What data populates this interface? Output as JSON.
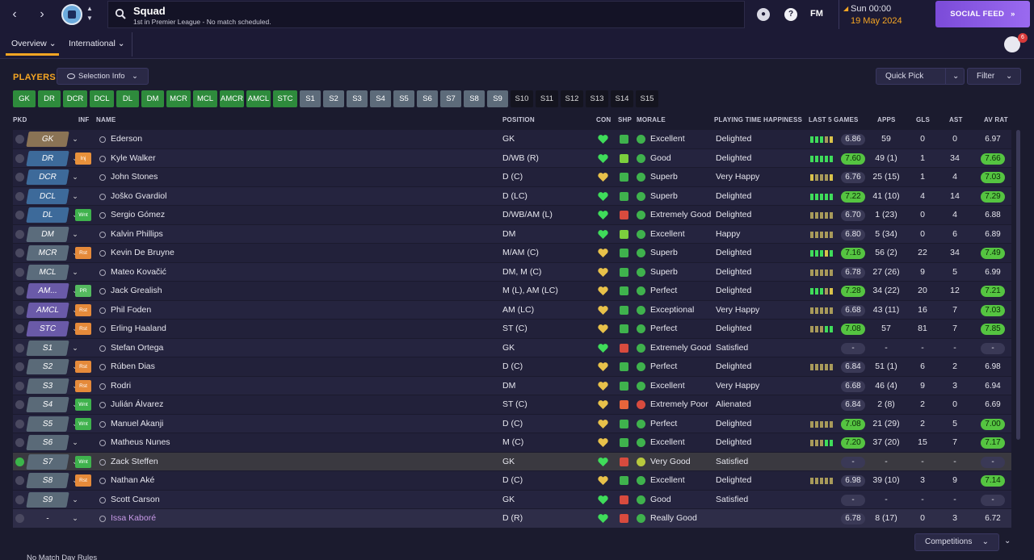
{
  "header": {
    "title": "Squad",
    "subtitle": "1st in Premier League - No match scheduled.",
    "fm_logo": "FM",
    "date_time": "Sun 00:00",
    "date_day": "19 May 2024",
    "social_feed": "SOCIAL FEED",
    "notification_count": "6"
  },
  "subnav": {
    "overview": "Overview",
    "international": "International"
  },
  "players": {
    "title": "PLAYERS",
    "selection_info": "Selection Info",
    "quick_pick": "Quick Pick",
    "filter": "Filter"
  },
  "chips": [
    {
      "label": "GK",
      "type": "filled"
    },
    {
      "label": "DR",
      "type": "filled"
    },
    {
      "label": "DCR",
      "type": "filled"
    },
    {
      "label": "DCL",
      "type": "filled"
    },
    {
      "label": "DL",
      "type": "filled"
    },
    {
      "label": "DM",
      "type": "filled"
    },
    {
      "label": "MCR",
      "type": "filled"
    },
    {
      "label": "MCL",
      "type": "filled"
    },
    {
      "label": "AMCR",
      "type": "filled"
    },
    {
      "label": "AMCL",
      "type": "filled"
    },
    {
      "label": "STC",
      "type": "filled"
    },
    {
      "label": "S1",
      "type": "sub"
    },
    {
      "label": "S2",
      "type": "sub"
    },
    {
      "label": "S3",
      "type": "sub"
    },
    {
      "label": "S4",
      "type": "sub"
    },
    {
      "label": "S5",
      "type": "sub"
    },
    {
      "label": "S6",
      "type": "sub"
    },
    {
      "label": "S7",
      "type": "sub"
    },
    {
      "label": "S8",
      "type": "sub"
    },
    {
      "label": "S9",
      "type": "sub"
    },
    {
      "label": "S10",
      "type": "res"
    },
    {
      "label": "S11",
      "type": "res"
    },
    {
      "label": "S12",
      "type": "res"
    },
    {
      "label": "S13",
      "type": "res"
    },
    {
      "label": "S14",
      "type": "res"
    },
    {
      "label": "S15",
      "type": "res"
    }
  ],
  "columns": {
    "pkd": "PKD",
    "inf": "INF",
    "name": "NAME",
    "position": "POSITION",
    "con": "CON",
    "shp": "SHP",
    "morale": "MORALE",
    "pth": "PLAYING TIME HAPPINESS",
    "last5": "LAST 5 GAMES",
    "apps": "APPS",
    "gls": "GLS",
    "ast": "AST",
    "avrat": "AV RAT"
  },
  "colors": {
    "accent": "#f6a623",
    "gk": "#8a7355",
    "defence": "#3d6a9a",
    "midfield": "#5b6c7c",
    "attack": "#6a5aa8",
    "sub": "#5a6a78",
    "good": "#55c441"
  },
  "rows": [
    {
      "pkd": "GK",
      "pos_color": "gk",
      "inf": "",
      "name": "Ederson",
      "position": "GK",
      "con": "green",
      "shp": "up",
      "morale": "Excellent",
      "mor": "green",
      "pth": "Delighted",
      "form": "gggmy",
      "last5": "6.86",
      "last5_good": false,
      "apps": "59",
      "gls": "0",
      "ast": "0",
      "avrat": "6.97",
      "avrat_style": "plain"
    },
    {
      "pkd": "DR",
      "pos_color": "defence",
      "inf": "Inj",
      "name": "Kyle Walker",
      "position": "D/WB (R)",
      "con": "green",
      "shp": "flat",
      "morale": "Good",
      "mor": "green",
      "pth": "Delighted",
      "form": "ggggg",
      "last5": "7.60",
      "last5_good": true,
      "apps": "49 (1)",
      "gls": "1",
      "ast": "34",
      "avrat": "7.66",
      "avrat_style": "good"
    },
    {
      "pkd": "DCR",
      "pos_color": "defence",
      "inf": "",
      "name": "John Stones",
      "position": "D (C)",
      "con": "yellow",
      "shp": "up",
      "morale": "Superb",
      "mor": "green",
      "pth": "Very Happy",
      "form": "ymmmy",
      "last5": "6.76",
      "last5_good": false,
      "apps": "25 (15)",
      "gls": "1",
      "ast": "4",
      "avrat": "7.03",
      "avrat_style": "good"
    },
    {
      "pkd": "DCL",
      "pos_color": "defence",
      "inf": "",
      "name": "Joško Gvardiol",
      "position": "D (LC)",
      "con": "green",
      "shp": "up",
      "morale": "Superb",
      "mor": "green",
      "pth": "Delighted",
      "form": "ggggg",
      "last5": "7.22",
      "last5_good": true,
      "apps": "41 (10)",
      "gls": "4",
      "ast": "14",
      "avrat": "7.29",
      "avrat_style": "good"
    },
    {
      "pkd": "DL",
      "pos_color": "defence",
      "inf": "Wnt",
      "name": "Sergio Gómez",
      "position": "D/WB/AM (L)",
      "con": "green",
      "shp": "down",
      "morale": "Extremely Good",
      "mor": "green",
      "pth": "Delighted",
      "form": "mmmmm",
      "last5": "6.70",
      "last5_good": false,
      "apps": "1 (23)",
      "gls": "0",
      "ast": "4",
      "avrat": "6.88",
      "avrat_style": "plain"
    },
    {
      "pkd": "DM",
      "pos_color": "midfield",
      "inf": "",
      "name": "Kalvin Phillips",
      "position": "DM",
      "con": "green",
      "shp": "flat",
      "morale": "Excellent",
      "mor": "green",
      "pth": "Happy",
      "form": "mmmmm",
      "last5": "6.80",
      "last5_good": false,
      "apps": "5 (34)",
      "gls": "0",
      "ast": "6",
      "avrat": "6.89",
      "avrat_style": "plain"
    },
    {
      "pkd": "MCR",
      "pos_color": "midfield",
      "inf": "Rst",
      "name": "Kevin De Bruyne",
      "position": "M/AM (C)",
      "con": "yellow",
      "shp": "up",
      "morale": "Superb",
      "mor": "green",
      "pth": "Delighted",
      "form": "gggyg",
      "last5": "7.16",
      "last5_good": true,
      "apps": "56 (2)",
      "gls": "22",
      "ast": "34",
      "avrat": "7.49",
      "avrat_style": "good"
    },
    {
      "pkd": "MCL",
      "pos_color": "midfield",
      "inf": "",
      "name": "Mateo Kovačić",
      "position": "DM, M (C)",
      "con": "yellow",
      "shp": "up",
      "morale": "Superb",
      "mor": "green",
      "pth": "Delighted",
      "form": "mmmmm",
      "last5": "6.78",
      "last5_good": false,
      "apps": "27 (26)",
      "gls": "9",
      "ast": "5",
      "avrat": "6.99",
      "avrat_style": "plain"
    },
    {
      "pkd": "AM...",
      "pos_color": "attack",
      "inf": "PR",
      "name": "Jack Grealish",
      "position": "M (L), AM (LC)",
      "con": "yellow",
      "shp": "up",
      "morale": "Perfect",
      "mor": "green",
      "pth": "Delighted",
      "form": "gggmy",
      "last5": "7.28",
      "last5_good": true,
      "apps": "34 (22)",
      "gls": "20",
      "ast": "12",
      "avrat": "7.21",
      "avrat_style": "good"
    },
    {
      "pkd": "AMCL",
      "pos_color": "attack",
      "inf": "Rst",
      "name": "Phil Foden",
      "position": "AM (LC)",
      "con": "yellow",
      "shp": "up",
      "morale": "Exceptional",
      "mor": "green",
      "pth": "Very Happy",
      "form": "mmmmm",
      "last5": "6.68",
      "last5_good": false,
      "apps": "43 (11)",
      "gls": "16",
      "ast": "7",
      "avrat": "7.03",
      "avrat_style": "good"
    },
    {
      "pkd": "STC",
      "pos_color": "attack",
      "inf": "Rst",
      "name": "Erling Haaland",
      "position": "ST (C)",
      "con": "yellow",
      "shp": "up",
      "morale": "Perfect",
      "mor": "green",
      "pth": "Delighted",
      "form": "mmmgg",
      "last5": "7.08",
      "last5_good": true,
      "apps": "57",
      "gls": "81",
      "ast": "7",
      "avrat": "7.85",
      "avrat_style": "good"
    },
    {
      "pkd": "S1",
      "pos_color": "sub",
      "inf": "",
      "name": "Stefan Ortega",
      "position": "GK",
      "con": "green",
      "shp": "down",
      "morale": "Extremely Good",
      "mor": "green",
      "pth": "Satisfied",
      "form": "",
      "last5": "-",
      "last5_good": false,
      "apps": "-",
      "gls": "-",
      "ast": "-",
      "avrat": "-",
      "avrat_style": "dash"
    },
    {
      "pkd": "S2",
      "pos_color": "sub",
      "inf": "Rst",
      "name": "Rúben Dias",
      "position": "D (C)",
      "con": "yellow",
      "shp": "up",
      "morale": "Perfect",
      "mor": "green",
      "pth": "Delighted",
      "form": "mmmmm",
      "last5": "6.84",
      "last5_good": false,
      "apps": "51 (1)",
      "gls": "6",
      "ast": "2",
      "avrat": "6.98",
      "avrat_style": "plain"
    },
    {
      "pkd": "S3",
      "pos_color": "sub",
      "inf": "Rst",
      "name": "Rodri",
      "position": "DM",
      "con": "yellow",
      "shp": "up",
      "morale": "Excellent",
      "mor": "green",
      "pth": "Very Happy",
      "form": "",
      "last5": "6.68",
      "last5_good": false,
      "apps": "46 (4)",
      "gls": "9",
      "ast": "3",
      "avrat": "6.94",
      "avrat_style": "plain"
    },
    {
      "pkd": "S4",
      "pos_color": "sub",
      "inf": "Wnt",
      "name": "Julián Álvarez",
      "position": "ST (C)",
      "con": "yellow",
      "shp": "warn",
      "morale": "Extremely Poor",
      "mor": "red",
      "pth": "Alienated",
      "form": "",
      "last5": "6.84",
      "last5_good": false,
      "apps": "2 (8)",
      "gls": "2",
      "ast": "0",
      "avrat": "6.69",
      "avrat_style": "plain"
    },
    {
      "pkd": "S5",
      "pos_color": "sub",
      "inf": "Wnt",
      "name": "Manuel Akanji",
      "position": "D (C)",
      "con": "yellow",
      "shp": "up",
      "morale": "Perfect",
      "mor": "green",
      "pth": "Delighted",
      "form": "mmmmm",
      "last5": "7.08",
      "last5_good": true,
      "apps": "21 (29)",
      "gls": "2",
      "ast": "5",
      "avrat": "7.00",
      "avrat_style": "good"
    },
    {
      "pkd": "S6",
      "pos_color": "sub",
      "inf": "",
      "name": "Matheus Nunes",
      "position": "M (C)",
      "con": "yellow",
      "shp": "up",
      "morale": "Excellent",
      "mor": "green",
      "pth": "Delighted",
      "form": "mmmgg",
      "last5": "7.20",
      "last5_good": true,
      "apps": "37 (20)",
      "gls": "15",
      "ast": "7",
      "avrat": "7.17",
      "avrat_style": "good"
    },
    {
      "pkd": "S7",
      "pos_color": "sub",
      "inf": "Wnt",
      "name": "Zack Steffen",
      "position": "GK",
      "con": "green",
      "shp": "down",
      "morale": "Very Good",
      "mor": "yellow",
      "pth": "Satisfied",
      "form": "",
      "last5": "-",
      "last5_good": false,
      "apps": "-",
      "gls": "-",
      "ast": "-",
      "avrat": "-",
      "avrat_style": "dash",
      "picked": true
    },
    {
      "pkd": "S8",
      "pos_color": "sub",
      "inf": "Rst",
      "name": "Nathan Aké",
      "position": "D (C)",
      "con": "yellow",
      "shp": "up",
      "morale": "Excellent",
      "mor": "green",
      "pth": "Delighted",
      "form": "mmmmm",
      "last5": "6.98",
      "last5_good": false,
      "apps": "39 (10)",
      "gls": "3",
      "ast": "9",
      "avrat": "7.14",
      "avrat_style": "good"
    },
    {
      "pkd": "S9",
      "pos_color": "sub",
      "inf": "",
      "name": "Scott Carson",
      "position": "GK",
      "con": "green",
      "shp": "down",
      "morale": "Good",
      "mor": "green",
      "pth": "Satisfied",
      "form": "",
      "last5": "-",
      "last5_good": false,
      "apps": "-",
      "gls": "-",
      "ast": "-",
      "avrat": "-",
      "avrat_style": "dash"
    },
    {
      "pkd": "-",
      "pos_color": "none",
      "inf": "",
      "name": "Issa Kaboré",
      "position": "D (R)",
      "con": "green",
      "shp": "down",
      "morale": "Really Good",
      "mor": "green",
      "pth": "",
      "form": "",
      "last5": "6.78",
      "last5_good": false,
      "apps": "8 (17)",
      "gls": "0",
      "ast": "3",
      "avrat": "6.72",
      "avrat_style": "plain",
      "loan": true
    }
  ],
  "footer": {
    "competitions": "Competitions",
    "match_day_rules": "No Match Day Rules"
  }
}
